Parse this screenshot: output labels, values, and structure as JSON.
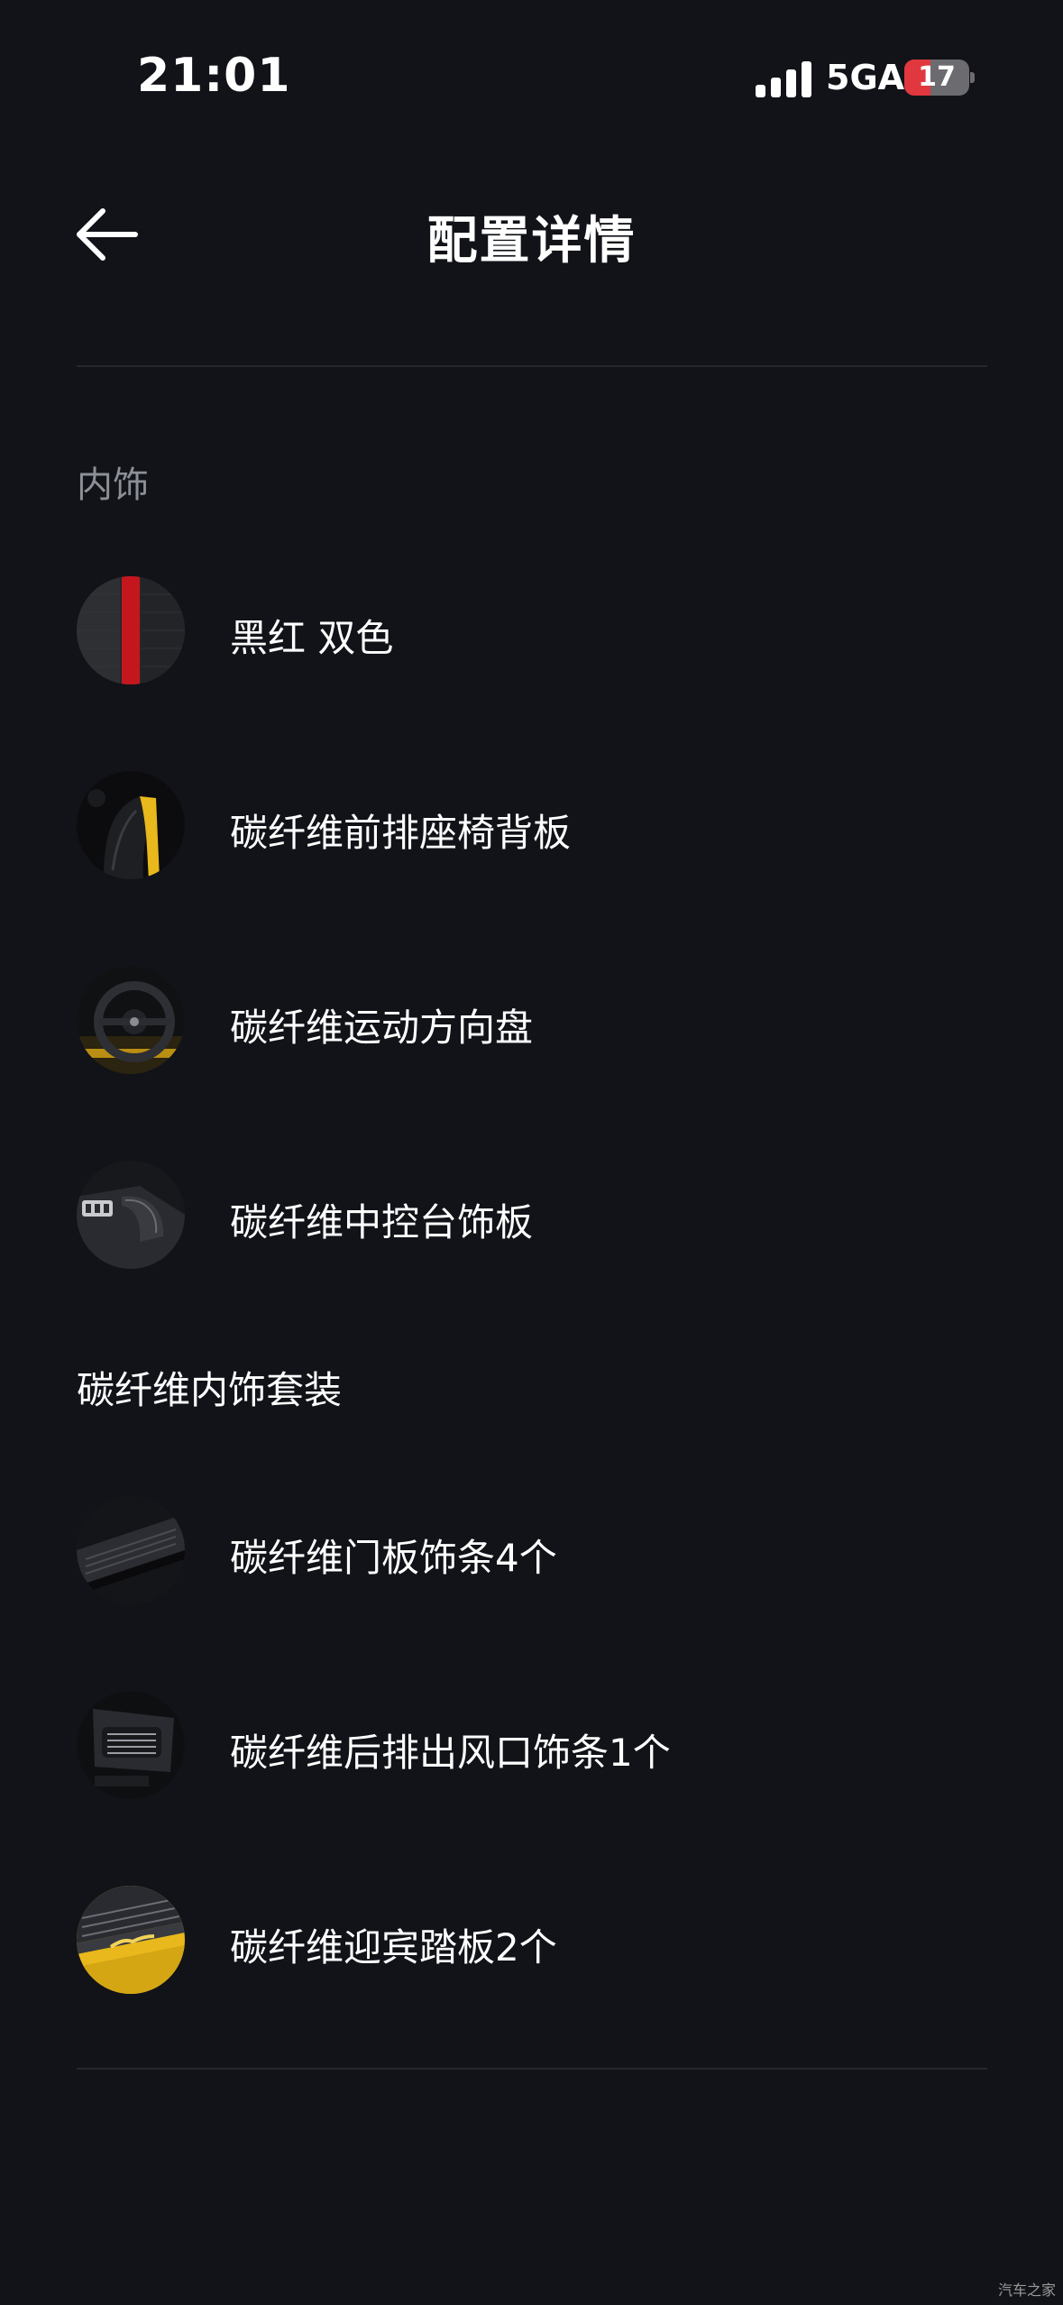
{
  "status_bar": {
    "time": "21:01",
    "network": "5GA",
    "battery_level": "17",
    "battery_fraction": 0.17
  },
  "header": {
    "title": "配置详情"
  },
  "sections": [
    {
      "label": "内饰",
      "items": [
        {
          "label": "黑红 双色",
          "thumb": "two-tone-leather-swatch"
        },
        {
          "label": "碳纤维前排座椅背板",
          "thumb": "seat-back-photo"
        },
        {
          "label": "碳纤维运动方向盘",
          "thumb": "steering-wheel-photo"
        },
        {
          "label": "碳纤维中控台饰板",
          "thumb": "console-trim-photo"
        }
      ]
    },
    {
      "label": "碳纤维内饰套装",
      "items": [
        {
          "label": "碳纤维门板饰条4个",
          "thumb": "door-trim-photo"
        },
        {
          "label": "碳纤维后排出风口饰条1个",
          "thumb": "rear-vent-photo"
        },
        {
          "label": "碳纤维迎宾踏板2个",
          "thumb": "sill-plate-photo"
        }
      ]
    }
  ],
  "watermark": "汽车之家",
  "colors": {
    "background": "#111318",
    "accent_red": "#e0383e",
    "accent_yellow": "#e8b81c",
    "muted_text": "#8c8f96"
  }
}
